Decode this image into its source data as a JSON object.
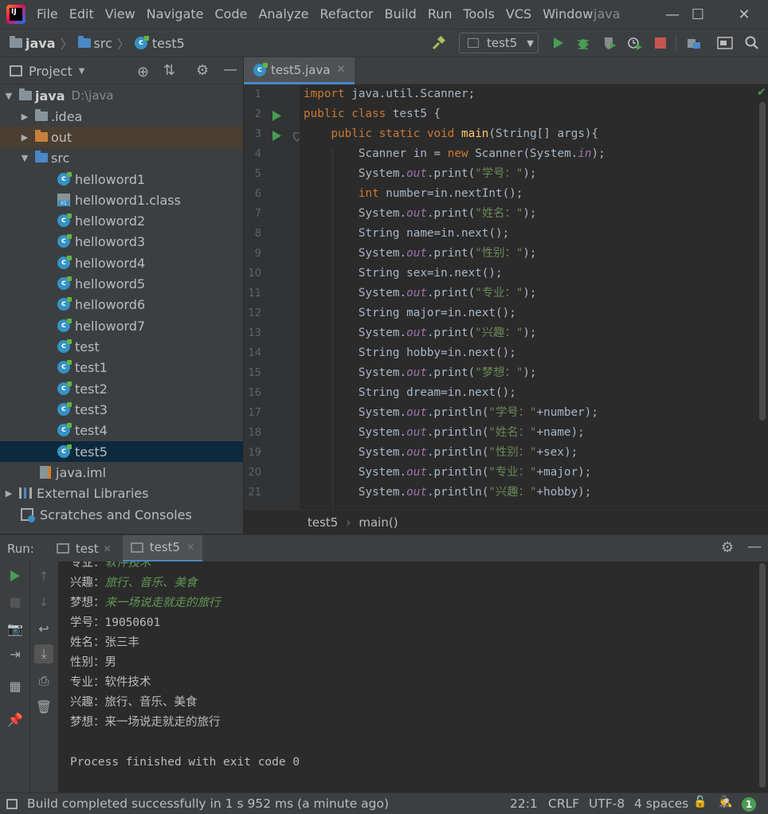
{
  "window": {
    "title": "java",
    "menu": [
      "File",
      "Edit",
      "View",
      "Navigate",
      "Code",
      "Analyze",
      "Refactor",
      "Build",
      "Run",
      "Tools",
      "VCS",
      "Window"
    ],
    "controls": {
      "minimize": "—",
      "maximize": "☐",
      "close": "✕"
    }
  },
  "navbar": {
    "breadcrumbs": [
      "java",
      "src",
      "test5"
    ],
    "run_config": "test5"
  },
  "project": {
    "title": "Project",
    "tree": [
      {
        "label": "java",
        "path": "D:\\java",
        "type": "root",
        "expanded": true
      },
      {
        "label": ".idea",
        "type": "folder",
        "expanded": false
      },
      {
        "label": "out",
        "type": "folder-orange",
        "expanded": false
      },
      {
        "label": "src",
        "type": "folder-blue",
        "expanded": true
      },
      {
        "label": "helloword1",
        "type": "class"
      },
      {
        "label": "helloword1.class",
        "type": "classfile"
      },
      {
        "label": "helloword2",
        "type": "class"
      },
      {
        "label": "helloword3",
        "type": "class"
      },
      {
        "label": "helloword4",
        "type": "class"
      },
      {
        "label": "helloword5",
        "type": "class"
      },
      {
        "label": "helloword6",
        "type": "class"
      },
      {
        "label": "helloword7",
        "type": "class"
      },
      {
        "label": "test",
        "type": "class"
      },
      {
        "label": "test1",
        "type": "class"
      },
      {
        "label": "test2",
        "type": "class"
      },
      {
        "label": "test3",
        "type": "class"
      },
      {
        "label": "test4",
        "type": "class"
      },
      {
        "label": "test5",
        "type": "class",
        "selected": true
      },
      {
        "label": "java.iml",
        "type": "iml"
      },
      {
        "label": "External Libraries",
        "type": "libs"
      },
      {
        "label": "Scratches and Consoles",
        "type": "scratch"
      }
    ]
  },
  "editor": {
    "tab": "test5.java",
    "line_numbers": [
      "1",
      "2",
      "3",
      "4",
      "5",
      "6",
      "7",
      "8",
      "9",
      "10",
      "11",
      "12",
      "13",
      "14",
      "15",
      "16",
      "17",
      "18",
      "19",
      "20",
      "21"
    ],
    "breadcrumb": [
      "test5",
      "main()"
    ]
  },
  "run": {
    "label": "Run:",
    "tabs": [
      "test",
      "test5"
    ],
    "output": [
      {
        "text": "专业：",
        "input": "软件技术"
      },
      {
        "text": "兴趣：",
        "input": "旅行、音乐、美食"
      },
      {
        "text": "梦想：",
        "input": "来一场说走就走的旅行"
      },
      {
        "text": "学号：19050601"
      },
      {
        "text": "姓名：张三丰"
      },
      {
        "text": "性别：男"
      },
      {
        "text": "专业：软件技术"
      },
      {
        "text": "兴趣：旅行、音乐、美食"
      },
      {
        "text": "梦想：来一场说走就走的旅行"
      },
      {
        "text": ""
      },
      {
        "text": "Process finished with exit code 0"
      }
    ]
  },
  "status": {
    "message": "Build completed successfully in 1 s 952 ms (a minute ago)",
    "position": "22:1",
    "line_sep": "CRLF",
    "encoding": "UTF-8",
    "indent": "4 spaces",
    "notifications": "1"
  },
  "colors": {
    "accent": "#4a88c7",
    "keyword": "#cc7832",
    "string": "#6a8759",
    "method": "#ffc66d",
    "field": "#9876aa",
    "run_green": "#499c54",
    "stop_red": "#c75450"
  }
}
